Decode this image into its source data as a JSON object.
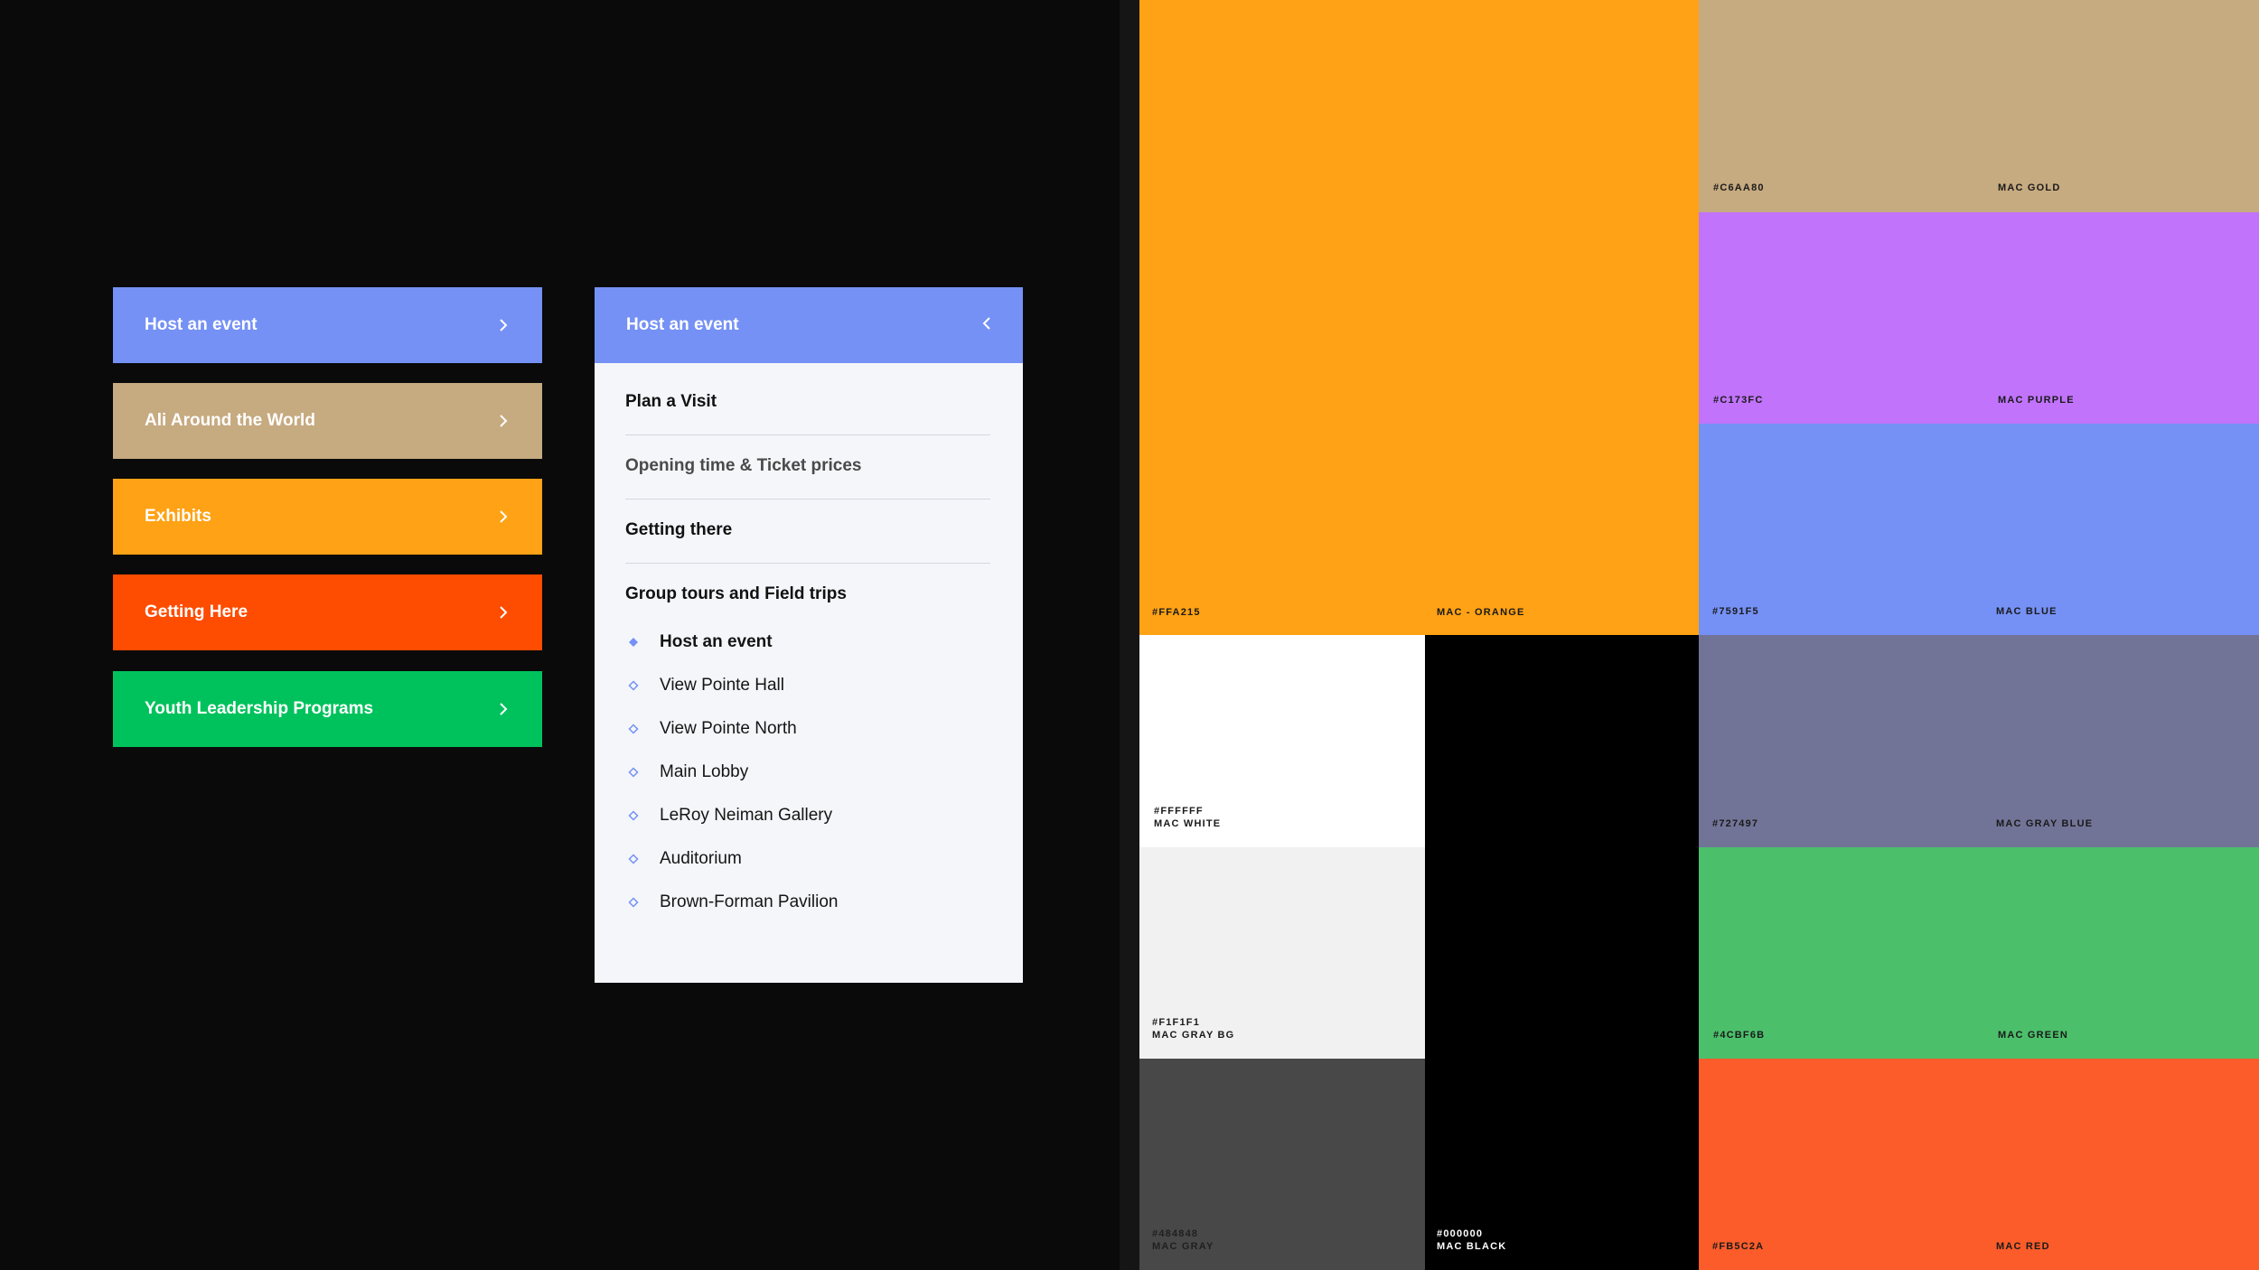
{
  "menu_bars": [
    {
      "label": "Host an event",
      "color": "#7591f5"
    },
    {
      "label": "Ali Around the World",
      "color": "#c6aa80"
    },
    {
      "label": "Exhibits",
      "color": "#ffa215"
    },
    {
      "label": "Getting Here",
      "color": "#fe4c00"
    },
    {
      "label": "Youth Leadership Programs",
      "color": "#00c25c"
    }
  ],
  "panel": {
    "header": "Host an event",
    "items": [
      "Plan a Visit",
      "Opening time & Ticket prices",
      "Getting there",
      "Group tours and Field trips"
    ],
    "sub_items": [
      "Host an event",
      "View Pointe Hall",
      "View Pointe North",
      "Main Lobby",
      "LeRoy Neiman Gallery",
      "Auditorium",
      "Brown-Forman Pavilion"
    ],
    "active_sub_item": "Host an event"
  },
  "palette": {
    "orange": {
      "hex": "#FFA215",
      "name": "MAC - ORANGE"
    },
    "white": {
      "hex": "#FFFFFF",
      "name": "MAC WHITE"
    },
    "gray_bg": {
      "hex": "#F1F1F1",
      "name": "MAC GRAY BG"
    },
    "gray": {
      "hex": "#484848",
      "name": "MAC GRAY"
    },
    "black": {
      "hex": "#000000",
      "name": "MAC BLACK"
    },
    "gold": {
      "hex": "#C6AA80",
      "name": "MAC GOLD"
    },
    "purple": {
      "hex": "#C173FC",
      "name": "MAC PURPLE"
    },
    "blue": {
      "hex": "#7591F5",
      "name": "MAC BLUE"
    },
    "gray_blue": {
      "hex": "#727497",
      "name": "MAC GRAY BLUE"
    },
    "green": {
      "hex": "#4CBF6B",
      "name": "MAC GREEN"
    },
    "red": {
      "hex": "#FB5C2A",
      "name": "MAC RED"
    }
  },
  "icons": {
    "bar_chevron": "chevron-right-icon",
    "panel_chevron": "chevron-left-icon",
    "bullet": "diamond-icon"
  }
}
